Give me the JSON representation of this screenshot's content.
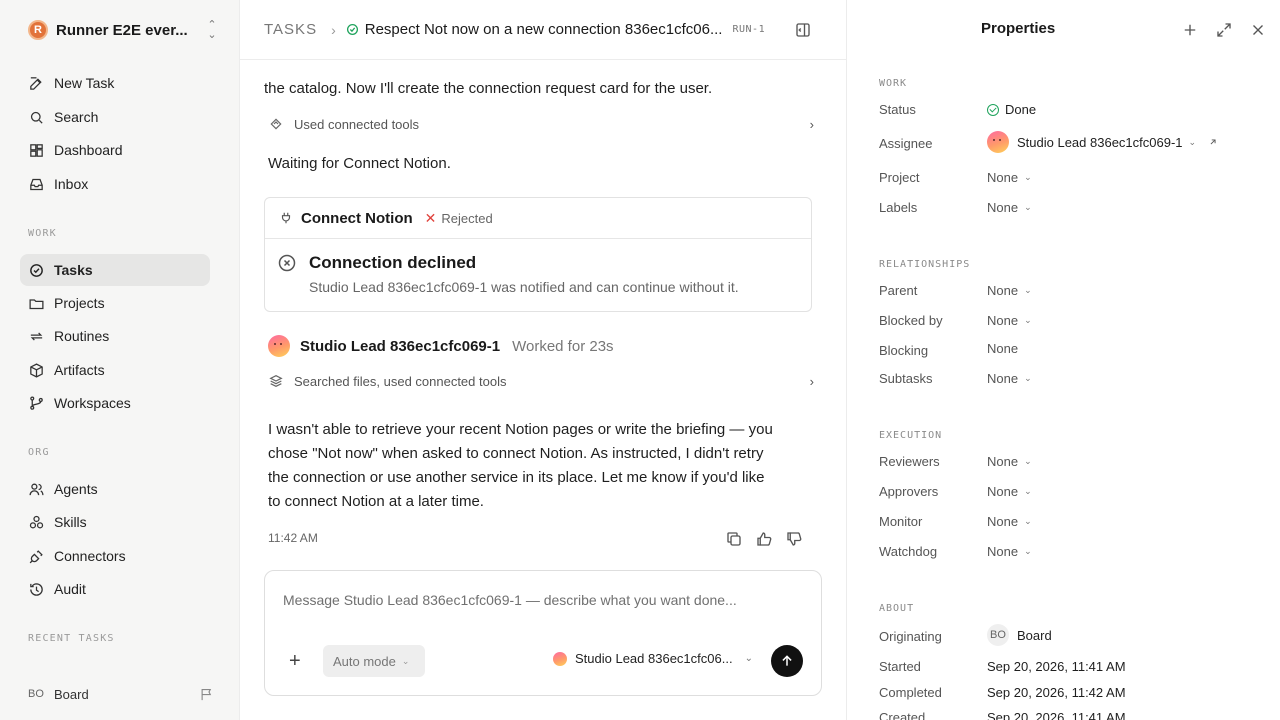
{
  "workspace": {
    "name": "Runner E2E ever...",
    "logo_letter": "R"
  },
  "sidebar": {
    "top_items": [
      {
        "label": "New Task",
        "icon": "edit-icon"
      },
      {
        "label": "Search",
        "icon": "search-icon"
      },
      {
        "label": "Dashboard",
        "icon": "dashboard-icon"
      },
      {
        "label": "Inbox",
        "icon": "inbox-icon"
      }
    ],
    "work_label": "WORK",
    "work_items": [
      {
        "label": "Tasks",
        "icon": "check-circle-icon",
        "active": true
      },
      {
        "label": "Projects",
        "icon": "folder-icon"
      },
      {
        "label": "Routines",
        "icon": "repeat-icon"
      },
      {
        "label": "Artifacts",
        "icon": "box-icon"
      },
      {
        "label": "Workspaces",
        "icon": "branch-icon"
      }
    ],
    "org_label": "ORG",
    "org_items": [
      {
        "label": "Agents",
        "icon": "users-icon"
      },
      {
        "label": "Skills",
        "icon": "skills-icon"
      },
      {
        "label": "Connectors",
        "icon": "plug-icon"
      },
      {
        "label": "Audit",
        "icon": "history-icon"
      }
    ],
    "recent_label": "RECENT TASKS",
    "footer": {
      "badge": "BO",
      "name": "Board"
    }
  },
  "header": {
    "root": "TASKS",
    "title": "Respect Not now on a new connection 836ec1cfc06...",
    "run_tag": "RUN-1"
  },
  "conversation": {
    "intro_text": "the catalog. Now I'll create the connection request card for the user.",
    "tools_1": "Used connected tools",
    "waiting_text": "Waiting for Connect Notion.",
    "card": {
      "title": "Connect Notion",
      "status": "Rejected",
      "decline_title": "Connection declined",
      "decline_sub": "Studio Lead 836ec1cfc069-1 was notified and can continue without it."
    },
    "agent_name": "Studio Lead 836ec1cfc069-1",
    "agent_meta": "Worked for 23s",
    "tools_2": "Searched files, used connected tools",
    "message_lines": [
      "I wasn't able to retrieve your recent Notion pages or write the briefing — you",
      "chose \"Not now\" when asked to connect Notion. As instructed, I didn't retry",
      "the connection or use another service in its place. Let me know if you'd like",
      "to connect Notion at a later time."
    ],
    "time": "11:42 AM"
  },
  "composer": {
    "placeholder": "Message Studio Lead 836ec1cfc069-1 — describe what you want done...",
    "mode": "Auto mode",
    "agent": "Studio Lead 836ec1cfc06..."
  },
  "properties": {
    "title": "Properties",
    "work_label": "WORK",
    "status_key": "Status",
    "status_val": "Done",
    "assignee_key": "Assignee",
    "assignee_val": "Studio Lead 836ec1cfc069-1",
    "project_key": "Project",
    "project_val": "None",
    "labels_key": "Labels",
    "labels_val": "None",
    "rel_label": "RELATIONSHIPS",
    "parent_key": "Parent",
    "parent_val": "None",
    "blockedby_key": "Blocked by",
    "blockedby_val": "None",
    "blocking_key": "Blocking",
    "blocking_val": "None",
    "subtasks_key": "Subtasks",
    "subtasks_val": "None",
    "exec_label": "EXECUTION",
    "reviewers_key": "Reviewers",
    "reviewers_val": "None",
    "approvers_key": "Approvers",
    "approvers_val": "None",
    "monitor_key": "Monitor",
    "monitor_val": "None",
    "watchdog_key": "Watchdog",
    "watchdog_val": "None",
    "about_label": "ABOUT",
    "orig_key": "Originating",
    "orig_badge": "BO",
    "orig_val": "Board",
    "started_key": "Started",
    "started_val": "Sep 20, 2026, 11:41 AM",
    "completed_key": "Completed",
    "completed_val": "Sep 20, 2026, 11:42 AM",
    "created_key": "Created",
    "created_val": "Sep 20, 2026, 11:41 AM"
  },
  "colors": {
    "done_green": "#1fa35c",
    "rejected_red": "#e0433d",
    "active_nav": "#e6e6e5"
  }
}
